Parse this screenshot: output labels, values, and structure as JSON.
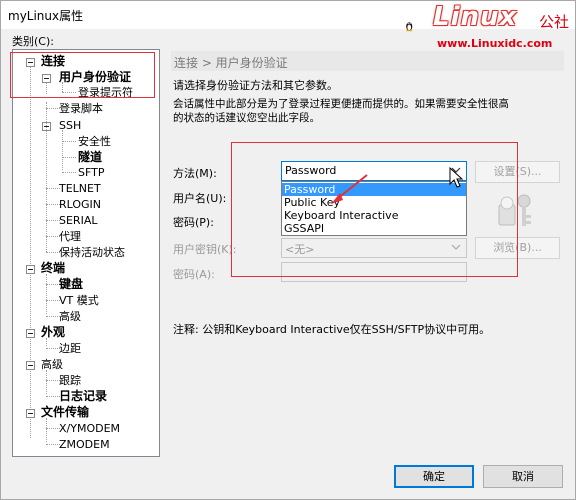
{
  "window": {
    "title": "myLinux属性"
  },
  "watermark": {
    "word": "Linux",
    "cn_suffix": "公社",
    "url": "www.Linuxidc.com"
  },
  "category_label": "类别(C):",
  "tree": [
    {
      "label": "连接",
      "style": "bold"
    },
    {
      "label": "用户身份验证",
      "style": "selected"
    },
    {
      "label": "登录提示符",
      "style": "normal"
    },
    {
      "label": "登录脚本",
      "style": "normal"
    },
    {
      "label": "SSH",
      "style": "normal"
    },
    {
      "label": "安全性",
      "style": "normal"
    },
    {
      "label": "隧道",
      "style": "bold"
    },
    {
      "label": "SFTP",
      "style": "normal"
    },
    {
      "label": "TELNET",
      "style": "normal"
    },
    {
      "label": "RLOGIN",
      "style": "normal"
    },
    {
      "label": "SERIAL",
      "style": "normal"
    },
    {
      "label": "代理",
      "style": "normal"
    },
    {
      "label": "保持活动状态",
      "style": "normal"
    },
    {
      "label": "终端",
      "style": "bold"
    },
    {
      "label": "键盘",
      "style": "bold"
    },
    {
      "label": "VT 模式",
      "style": "normal"
    },
    {
      "label": "高级",
      "style": "normal"
    },
    {
      "label": "外观",
      "style": "bold"
    },
    {
      "label": "边距",
      "style": "normal"
    },
    {
      "label": "高级",
      "style": "normal"
    },
    {
      "label": "跟踪",
      "style": "normal"
    },
    {
      "label": "日志记录",
      "style": "bold"
    },
    {
      "label": "文件传输",
      "style": "bold"
    },
    {
      "label": "X/YMODEM",
      "style": "normal"
    },
    {
      "label": "ZMODEM",
      "style": "normal"
    }
  ],
  "panel": {
    "breadcrumb": "连接 > 用户身份验证",
    "intro_line1": "请选择身份验证方法和其它参数。",
    "intro_line2": "会话属性中此部分是为了登录过程更便捷而提供的。如果需要安全性很高",
    "intro_line3": "的状态的话建议您空出此字段。",
    "method_label": "方法(M):",
    "method_value": "Password",
    "setup_button": "设置(S)...",
    "username_label": "用户名(U):",
    "password_label": "密码(P):",
    "user_key_label": "用户密钥(K):",
    "user_key_value": "<无>",
    "browse_button": "浏览(B)...",
    "passphrase_label": "密码(A):",
    "method_options": [
      "Password",
      "Public Key",
      "Keyboard Interactive",
      "GSSAPI"
    ],
    "method_highlighted": "Password",
    "note": "注释: 公钥和Keyboard Interactive仅在SSH/SFTP协议中可用。"
  },
  "buttons": {
    "ok": "确定",
    "cancel": "取消"
  },
  "colors": {
    "annotation_red": "#e0303a",
    "selection_blue": "#3399ff",
    "primary_border": "#0078d7"
  }
}
